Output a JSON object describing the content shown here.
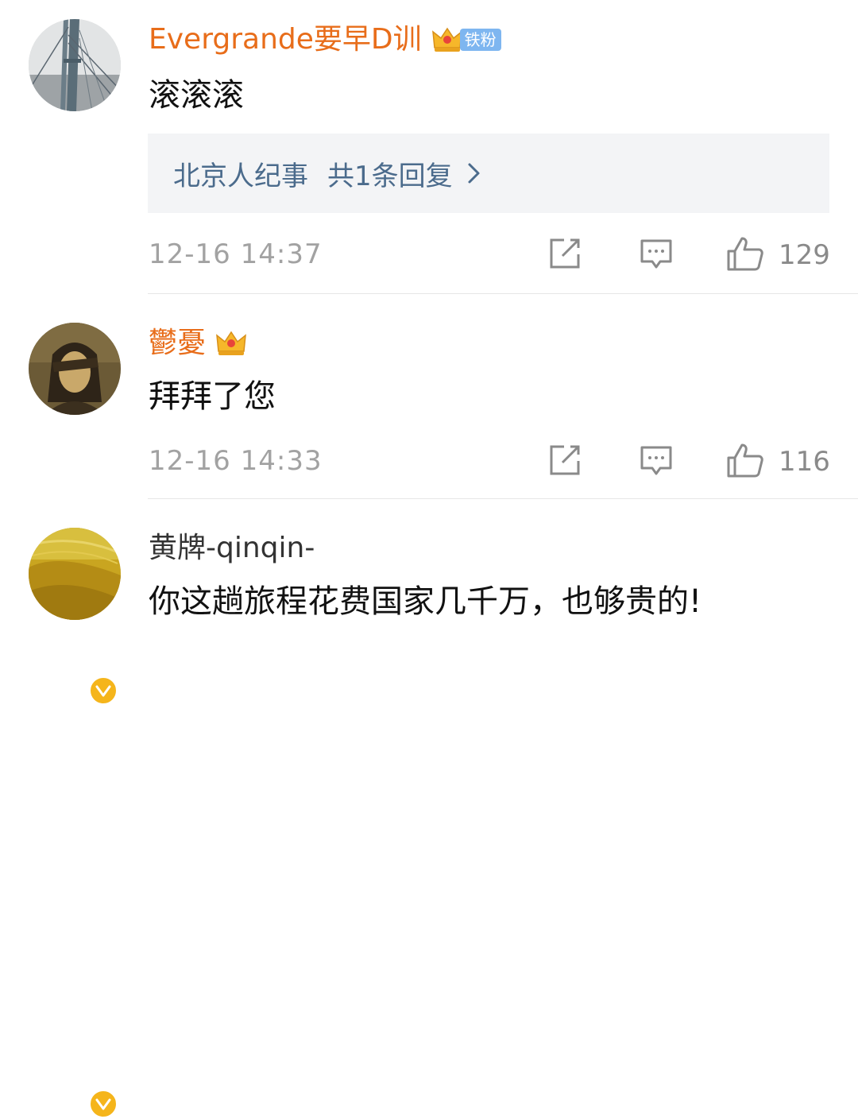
{
  "comments": [
    {
      "username": "Evergrande要早D训",
      "badge": "铁粉",
      "content": "滚滚滚",
      "reply_user": "北京人纪事",
      "reply_count": "共1条回复",
      "time": "12-16 14:37",
      "likes": "129"
    },
    {
      "username": "鬱憂",
      "content": "拜拜了您",
      "time": "12-16 14:33",
      "likes": "116"
    },
    {
      "username": "黄牌-qinqin-",
      "content": "你这趟旅程花费国家几千万，也够贵的!"
    }
  ],
  "colors": {
    "vip_name": "#e86d1a",
    "reply_link": "#4b6b8c",
    "meta": "#a2a2a2",
    "verified": "#f5b51b"
  },
  "icons": [
    "crown-icon",
    "repost-icon",
    "comment-icon",
    "like-icon",
    "chevron-right-icon",
    "verified-icon"
  ]
}
